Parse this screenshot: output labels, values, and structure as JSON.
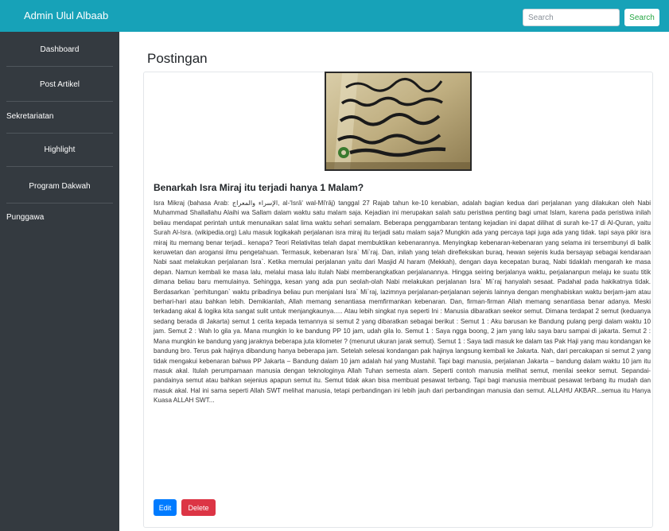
{
  "header": {
    "brand": "Admin Ulul Albaab",
    "search_placeholder": "Search",
    "search_button": "Search"
  },
  "sidebar": {
    "items": [
      {
        "label": "Dashboard"
      },
      {
        "label": "Post Artikel"
      },
      {
        "label": "Sekretariatan"
      },
      {
        "label": "Highlight"
      },
      {
        "label": "Program Dakwah"
      },
      {
        "label": "Punggawa"
      }
    ]
  },
  "main": {
    "page_title": "Postingan",
    "post": {
      "title": "Benarkah Isra Miraj itu terjadi hanya 1 Malam?",
      "body": "Isra Mikraj (bahasa Arab: الإسراء والمعراج, al-'Isrā' wal-Mi'rāj) tanggal 27 Rajab tahun ke-10 kenabian, adalah bagian kedua dari perjalanan yang dilakukan oleh Nabi Muhammad Shallallahu Alaihi wa Sallam dalam waktu satu malam saja. Kejadian ini merupakan salah satu peristiwa penting bagi umat Islam, karena pada peristiwa inilah beliau mendapat perintah untuk menunaikan salat lima waktu sehari semalam. Beberapa penggambaran tentang kejadian ini dapat dilihat di surah ke-17 di Al-Quran, yaitu Surah Al-Isra. (wikipedia.org) Lalu masuk logikakah perjalanan isra miraj itu terjadi satu malam saja? Mungkin ada yang percaya tapi juga ada yang tidak. tapi saya pikir isra miraj itu memang benar terjadi.. kenapa? Teori Relativitas telah dapat membuktikan kebenarannya. Menyingkap kebenaran-kebenaran yang selama ini tersembunyi di balik keruwetan dan arogansi ilmu pengetahuan. Termasuk, kebenaran Isra` Mi`raj. Dan, inilah yang telah direfleksikan buraq, hewan sejenis kuda bersayap sebagai kendaraan Nabi saat melakukan perjalanan Isra`. Ketika memulai perjalanan yaitu dari Masjid Al haram (Mekkah), dengan daya kecepatan buraq, Nabi tidaklah mengarah ke masa depan. Namun kembali ke masa lalu, melalui masa lalu itulah Nabi memberangkatkan perjalanannya. Hingga seiring berjalanya waktu, perjalananpun melaju ke suatu titik dimana beliau baru memulainya. Sehingga, kesan yang ada pun seolah-olah Nabi melakukan perjalanan Isra` Mi`raj hanyalah sesaat. Padahal pada hakikatnya tidak. Berdasarkan `perhitungan` waktu pribadinya beliau pun menjalani Isra` Mi`raj, lazimnya perjalanan-perjalanan sejenis lainnya dengan menghabiskan waktu berjam-jam atau berhari-hari atau bahkan lebih. Demikianlah, Allah memang senantiasa memfirmankan kebenaran. Dan, firman-firman Allah memang senantiasa benar adanya. Meski terkadang akal & logika kita sangat sulit untuk menjangkaunya..... Atau lebih singkat nya seperti Ini : Manusia dibaratkan seekor semut. Dimana terdapat 2 semut (keduanya sedang berada di Jakarta) semut 1 cerita kepada temannya si semut 2 yang dibaratkan sebagai berikut : Semut 1 : Aku barusan ke Bandung pulang pergi dalam waktu 10 jam. Semut 2 : Wah lo gila ya. Mana mungkin lo ke bandung PP 10 jam, udah gila lo. Semut 1 : Saya ngga boong, 2 jam yang lalu saya baru sampai di jakarta. Semut 2 : Mana mungkin ke bandung yang jaraknya beberapa juta kilometer ? (menurut ukuran jarak semut). Semut 1 : Saya tadi masuk ke dalam tas Pak Haji yang mau kondangan ke bandung bro. Terus pak hajinya dibandung hanya beberapa jam. Setelah selesai kondangan pak hajinya langsung kembali ke Jakarta. Nah, dari percakapan si semut 2 yang tidak mengakui kebenaran bahwa PP Jakarta – Bandung dalam 10 jam adalah hal yang Mustahil. Tapi bagi manusia, perjalanan Jakarta – bandung dalam waktu 10 jam itu masuk akal. Itulah perumpamaan manusia dengan teknologinya Allah Tuhan semesta alam. Seperti contoh manusia melihat semut, menilai seekor semut. Sepandai-pandainya semut atau bahkan sejenius apapun semut itu. Semut tidak akan bisa membuat pesawat terbang. Tapi bagi manusia membuat pesawat terbang itu mudah dan masuk akal. Hal ini sama seperti Allah SWT melihat manusia, tetapi perbandingan ini lebih jauh dari perbandingan manusia dan semut. ALLAHU AKBAR...semua itu Hanya Kuasa ALLAH SWT...",
      "edit_label": "Edit",
      "delete_label": "Delete"
    }
  },
  "colors": {
    "topbar": "#17a2b8",
    "sidebar": "#343a40",
    "edit_button": "#007bff",
    "delete_button": "#dc3545",
    "search_text": "#28a745"
  },
  "icons": {
    "post_image": "quran-verse-image"
  }
}
